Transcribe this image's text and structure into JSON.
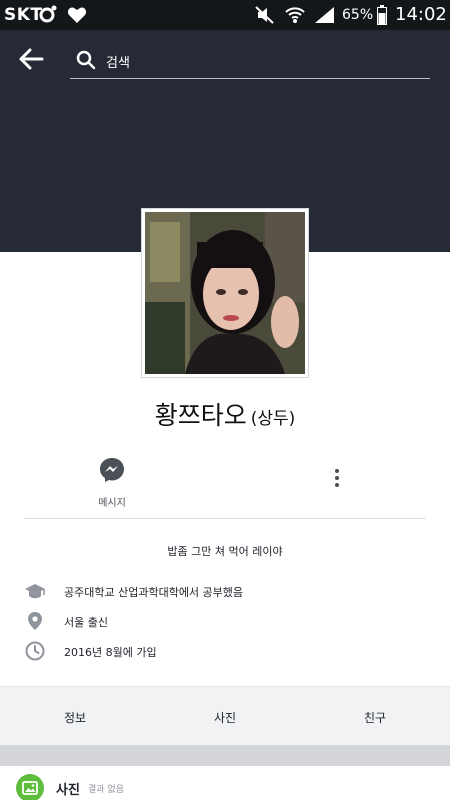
{
  "status_bar": {
    "carrier": "SKT",
    "battery": "65%",
    "time": "14:02"
  },
  "header": {
    "search_text": "검색"
  },
  "profile": {
    "name": "황쯔타오",
    "alt_name": "(상두)",
    "bio": "밥좀 그만 쳐 먹어 레이야"
  },
  "actions": {
    "message_label": "메시지"
  },
  "info": [
    {
      "icon": "graduation-cap-icon",
      "text": "공주대학교 산업과학대학에서 공부했음"
    },
    {
      "icon": "location-pin-icon",
      "text": "서울 출신"
    },
    {
      "icon": "clock-icon",
      "text": "2016년 8월에 가입"
    }
  ],
  "tabs": [
    {
      "label": "정보"
    },
    {
      "label": "사진"
    },
    {
      "label": "친구"
    }
  ],
  "photos_section": {
    "title": "사진",
    "subtitle": "결과 없음"
  },
  "colors": {
    "cover": "#252a36",
    "status_bar": "#14171a",
    "accent": "#4b4f56",
    "photos_icon": "#5fbd3d"
  }
}
